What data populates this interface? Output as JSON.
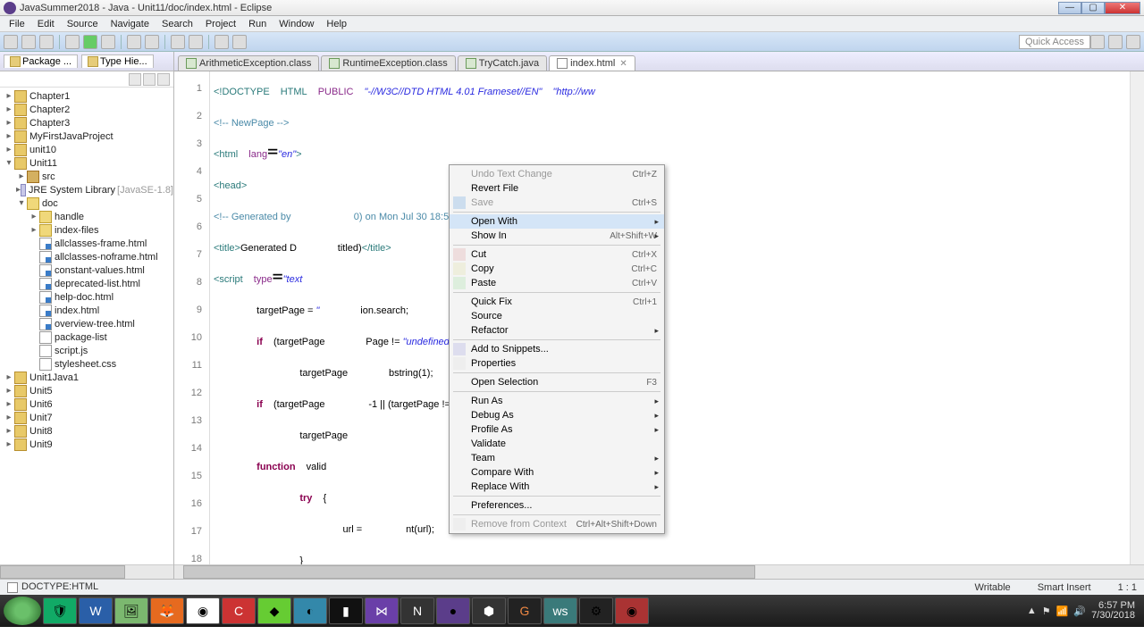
{
  "window": {
    "title": "JavaSummer2018 - Java - Unit11/doc/index.html - Eclipse"
  },
  "menu": [
    "File",
    "Edit",
    "Source",
    "Navigate",
    "Search",
    "Project",
    "Run",
    "Window",
    "Help"
  ],
  "quickaccess": "Quick Access",
  "sidebar_tabs": {
    "t1": "Package ...",
    "t2": "Type Hie..."
  },
  "tree": {
    "chapter1": "Chapter1",
    "chapter2": "Chapter2",
    "chapter3": "Chapter3",
    "myfirst": "MyFirstJavaProject",
    "unit10": "unit10",
    "unit11": "Unit11",
    "src": "src",
    "jre": "JRE System Library",
    "jrev": "[JavaSE-1.8]",
    "doc": "doc",
    "handle": "handle",
    "indexfiles": "index-files",
    "allframe": "allclasses-frame.html",
    "allnoframe": "allclasses-noframe.html",
    "constv": "constant-values.html",
    "deprec": "deprecated-list.html",
    "helpdoc": "help-doc.html",
    "indexhtml": "index.html",
    "ovtree": "overview-tree.html",
    "pkglist": "package-list",
    "scriptjs": "script.js",
    "stylecss": "stylesheet.css",
    "unit1j1": "Unit1Java1",
    "unit5": "Unit5",
    "unit6": "Unit6",
    "unit7": "Unit7",
    "unit8": "Unit8",
    "unit9": "Unit9"
  },
  "editor_tabs": {
    "t1": "ArithmeticException.class",
    "t2": "RuntimeException.class",
    "t3": "TryCatch.java",
    "t4": "index.html"
  },
  "code_lines": {
    "ln": [
      "1",
      "2",
      "3",
      "4",
      "5",
      "6",
      "7",
      "8",
      "9",
      "10",
      "11",
      "12",
      "13",
      "14",
      "15",
      "16",
      "17",
      "18"
    ]
  },
  "ctx": {
    "undotext": "Undo Text Change",
    "sc_undo": "Ctrl+Z",
    "revert": "Revert File",
    "save": "Save",
    "sc_save": "Ctrl+S",
    "openwith": "Open With",
    "showin": "Show In",
    "sc_showin": "Alt+Shift+W",
    "cut": "Cut",
    "sc_cut": "Ctrl+X",
    "copy": "Copy",
    "sc_copy": "Ctrl+C",
    "paste": "Paste",
    "sc_paste": "Ctrl+V",
    "quickfix": "Quick Fix",
    "sc_quick": "Ctrl+1",
    "source": "Source",
    "refactor": "Refactor",
    "addsnip": "Add to Snippets...",
    "props": "Properties",
    "opensel": "Open Selection",
    "sc_opensel": "F3",
    "runas": "Run As",
    "debugas": "Debug As",
    "profileas": "Profile As",
    "validate": "Validate",
    "team": "Team",
    "compare": "Compare With",
    "replace": "Replace With",
    "prefs": "Preferences...",
    "remove": "Remove from Context",
    "sc_remove": "Ctrl+Alt+Shift+Down"
  },
  "status": {
    "left": "DOCTYPE:HTML",
    "writable": "Writable",
    "smart": "Smart Insert",
    "pos": "1 : 1"
  },
  "tray": {
    "time": "6:57 PM",
    "date": "7/30/2018"
  }
}
